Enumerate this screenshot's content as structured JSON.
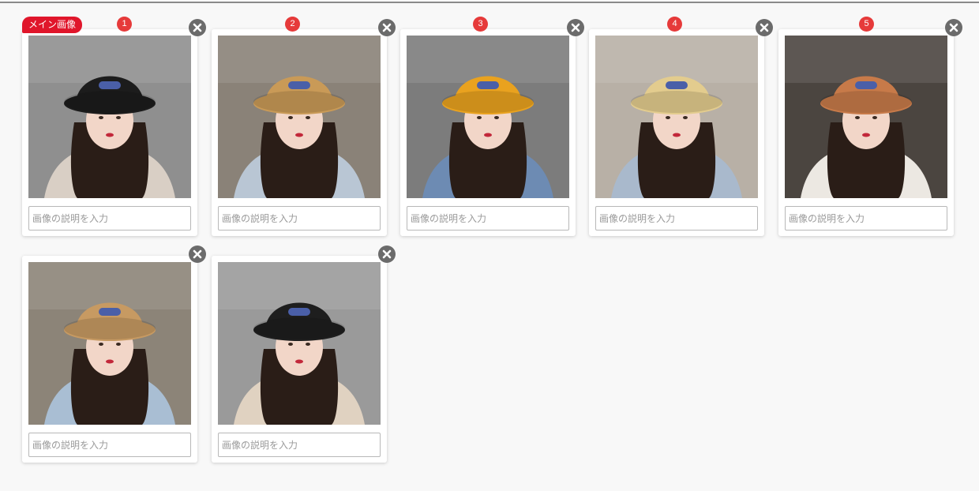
{
  "main_image_badge": "メイン画像",
  "description_placeholder": "画像の説明を入力",
  "order_numbers": [
    "1",
    "2",
    "3",
    "4",
    "5"
  ],
  "colors": {
    "badge_red": "#e0162b",
    "order_red": "#e63a3a",
    "close_gray": "#6b6b6b"
  },
  "images": [
    {
      "hat_color": "#1c1c1c",
      "bg_color": "#8f8f8f",
      "top_color": "#d9cfc5",
      "icon": "photo-black-bucket-hat"
    },
    {
      "hat_color": "#c99a57",
      "bg_color": "#8a8278",
      "top_color": "#b9c6d4",
      "icon": "photo-camel-bucket-hat"
    },
    {
      "hat_color": "#e9a21f",
      "bg_color": "#7c7c7c",
      "top_color": "#6d8bb3",
      "icon": "photo-mustard-bucket-hat"
    },
    {
      "hat_color": "#e3cc8e",
      "bg_color": "#b8b0a6",
      "top_color": "#a9b9cc",
      "icon": "photo-beige-bucket-hat"
    },
    {
      "hat_color": "#c77a49",
      "bg_color": "#4b4540",
      "top_color": "#ece8e2",
      "icon": "photo-orange-bucket-hat"
    },
    {
      "hat_color": "#c79a62",
      "bg_color": "#8c8478",
      "top_color": "#a9bed3",
      "icon": "photo-camel-bucket-hat-wave"
    },
    {
      "hat_color": "#1e1e1e",
      "bg_color": "#9a9a9a",
      "top_color": "#e0d2c1",
      "icon": "photo-black-bucket-hat-2"
    }
  ]
}
